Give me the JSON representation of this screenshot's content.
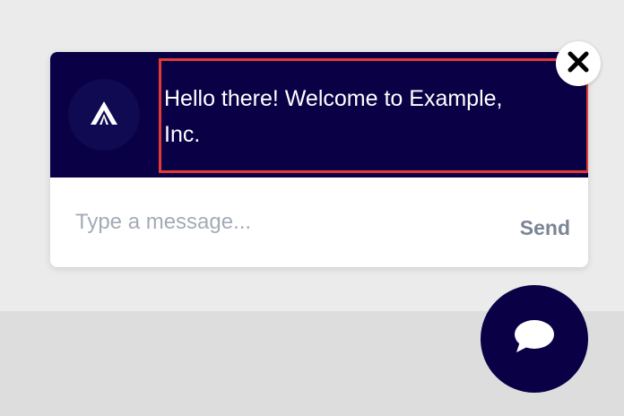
{
  "chat": {
    "greeting": "Hello there! Welcome to Example, Inc.",
    "input_placeholder": "Type a message...",
    "input_value": "",
    "send_label": "Send"
  },
  "icons": {
    "avatar": "brand-logo-icon",
    "close": "close-icon",
    "launcher": "chat-bubble-icon"
  },
  "colors": {
    "header_bg": "#0a0046",
    "highlight_border": "#e53935",
    "send_text": "#7b8594",
    "placeholder": "#a4abb6",
    "page_bg": "#ebebeb"
  }
}
